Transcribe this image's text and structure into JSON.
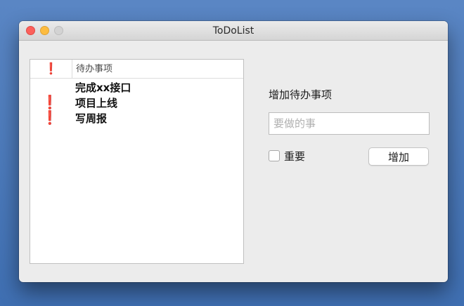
{
  "window": {
    "title": "ToDoList"
  },
  "table": {
    "columns": {
      "important": "❗",
      "task": "待办事项"
    },
    "rows": [
      {
        "important": "",
        "task": "完成xx接口"
      },
      {
        "important": "❗",
        "task": "项目上线"
      },
      {
        "important": "❗",
        "task": "写周报"
      }
    ]
  },
  "form": {
    "title": "增加待办事项",
    "input": {
      "placeholder": "要做的事",
      "value": ""
    },
    "important_label": "重要",
    "important_checked": false,
    "add_label": "增加"
  },
  "colors": {
    "important": "#d0021b"
  }
}
